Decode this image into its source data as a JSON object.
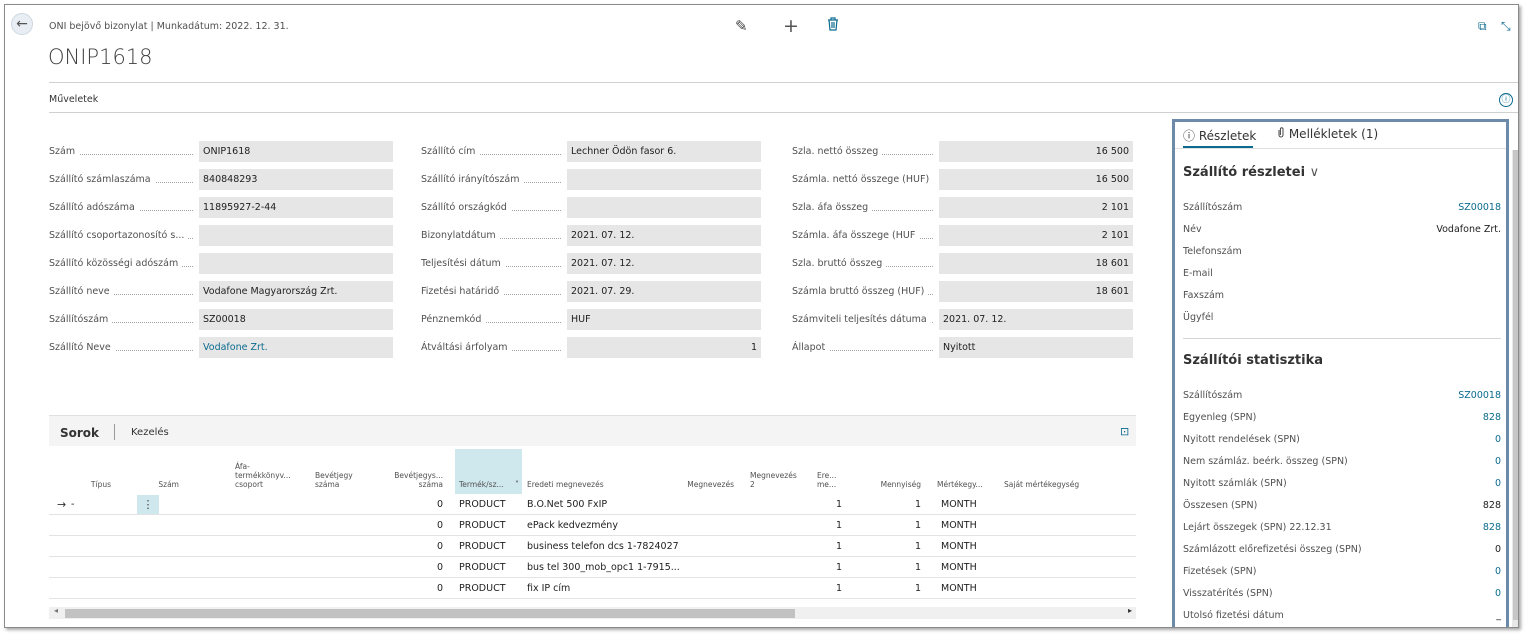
{
  "header": {
    "caption": "ONI bejövő bizonylat | Munkadátum: 2022. 12. 31.",
    "title": "ONIP1618"
  },
  "icons": {
    "back": "←",
    "edit": "✎",
    "new": "+",
    "delete": "🗑",
    "popout": "⧉",
    "collapse": "⤡",
    "info": "ⓘ",
    "paperclip": "⊘",
    "expand": "⊡",
    "row_arrow": "→",
    "chevron": "∨",
    "sort_down": "˅",
    "menu_dots": "⋮",
    "scroll_left": "◂",
    "scroll_right": "▸"
  },
  "actions_label": "Műveletek",
  "col1": [
    {
      "label": "Szám",
      "value": "ONIP1618"
    },
    {
      "label": "Szállító számlaszáma",
      "value": "840848293"
    },
    {
      "label": "Szállító adószáma",
      "value": "11895927-2-44"
    },
    {
      "label": "Szállító csoportazonosító s...",
      "value": ""
    },
    {
      "label": "Szállító közösségi adószám",
      "value": ""
    },
    {
      "label": "Szállító neve",
      "value": "Vodafone Magyarország Zrt."
    },
    {
      "label": "Szállítószám",
      "value": "SZ00018"
    },
    {
      "label": "Szállító Neve",
      "value": "Vodafone Zrt."
    }
  ],
  "col2": [
    {
      "label": "Szállító cím",
      "value": "Lechner Ödön fasor 6."
    },
    {
      "label": "Szállító irányítószám",
      "value": ""
    },
    {
      "label": "Szállító országkód",
      "value": ""
    },
    {
      "label": "Bizonylatdátum",
      "value": "2021. 07. 12."
    },
    {
      "label": "Teljesítési dátum",
      "value": "2021. 07. 12."
    },
    {
      "label": "Fizetési határidő",
      "value": "2021. 07. 29."
    },
    {
      "label": "Pénznemkód",
      "value": "HUF"
    },
    {
      "label": "Átváltási árfolyam",
      "value": "1"
    }
  ],
  "col3": [
    {
      "label": "Szla. nettó összeg",
      "value": "16 500"
    },
    {
      "label": "Számla. nettó összege (HUF)",
      "value": "16 500"
    },
    {
      "label": "Szla. áfa összeg",
      "value": "2 101"
    },
    {
      "label": "Számla. áfa összege (HUF",
      "value": "2 101"
    },
    {
      "label": "Szla. bruttó összeg",
      "value": "18 601"
    },
    {
      "label": "Számla bruttó összeg (HUF)",
      "value": "18 601"
    },
    {
      "label": "Számviteli teljesítés dátuma",
      "value": "2021. 07. 12."
    },
    {
      "label": "Állapot",
      "value": "Nyitott"
    }
  ],
  "lines": {
    "tab_active": "Sorok",
    "tab_other": "Kezelés",
    "columns": [
      "Típus",
      "Szám",
      "Áfa-\ntermékkönyv...\ncsoport",
      "Bevétjegy\nszáma",
      "Bevétjegys...\nszáma",
      "Termék/sz...",
      "Eredeti megnevezés",
      "Megnevezés",
      "Megnevezés\n2",
      "Ere...\nme...",
      "Mennyiség",
      "Mértékegy...",
      "Saját mértékegység"
    ],
    "rows": [
      {
        "tipus": "-",
        "bev": "0",
        "termek": "PRODUCT",
        "eredeti": "B.O.Net 500 FxIP",
        "ere": "1",
        "menny": "1",
        "mert": "MONTH"
      },
      {
        "tipus": "",
        "bev": "0",
        "termek": "PRODUCT",
        "eredeti": "ePack kedvezmény",
        "ere": "1",
        "menny": "1",
        "mert": "MONTH"
      },
      {
        "tipus": "",
        "bev": "0",
        "termek": "PRODUCT",
        "eredeti": "business telefon dcs 1-7824027",
        "ere": "1",
        "menny": "1",
        "mert": "MONTH"
      },
      {
        "tipus": "",
        "bev": "0",
        "termek": "PRODUCT",
        "eredeti": "bus tel 300_mob_opc1 1-7915...",
        "ere": "1",
        "menny": "1",
        "mert": "MONTH"
      },
      {
        "tipus": "",
        "bev": "0",
        "termek": "PRODUCT",
        "eredeti": "fix IP cím",
        "ere": "1",
        "menny": "1",
        "mert": "MONTH"
      }
    ]
  },
  "factbox": {
    "tab_details": "Részletek",
    "tab_attachments": "Mellékletek (1)",
    "sec1_title": "Szállító részletei",
    "sec1": [
      {
        "label": "Szállítószám",
        "value": "SZ00018",
        "link": true
      },
      {
        "label": "Név",
        "value": "Vodafone Zrt.",
        "link": false
      },
      {
        "label": "Telefonszám",
        "value": "",
        "link": false
      },
      {
        "label": "E-mail",
        "value": "",
        "link": false
      },
      {
        "label": "Faxszám",
        "value": "",
        "link": false
      },
      {
        "label": "Ügyfél",
        "value": "",
        "link": false
      }
    ],
    "sec2_title": "Szállítói statisztika",
    "sec2": [
      {
        "label": "Szállítószám",
        "value": "SZ00018",
        "link": true
      },
      {
        "label": "Egyenleg (SPN)",
        "value": "828",
        "link": true
      },
      {
        "label": "Nyitott rendelések (SPN)",
        "value": "0",
        "link": true
      },
      {
        "label": "Nem számláz. beérk. összeg (SPN)",
        "value": "0",
        "link": true
      },
      {
        "label": "Nyitott számlák (SPN)",
        "value": "0",
        "link": true
      },
      {
        "label": "Összesen (SPN)",
        "value": "828",
        "link": false
      },
      {
        "label": "Lejárt összegek (SPN) 22.12.31",
        "value": "828",
        "link": true
      },
      {
        "label": "Számlázott előrefizetési összeg (SPN)",
        "value": "0",
        "link": false
      },
      {
        "label": "Fizetések (SPN)",
        "value": "0",
        "link": true
      },
      {
        "label": "Visszatérítés (SPN)",
        "value": "0",
        "link": true
      },
      {
        "label": "Utolsó fizetési dátum",
        "value": "_",
        "link": false
      }
    ]
  }
}
